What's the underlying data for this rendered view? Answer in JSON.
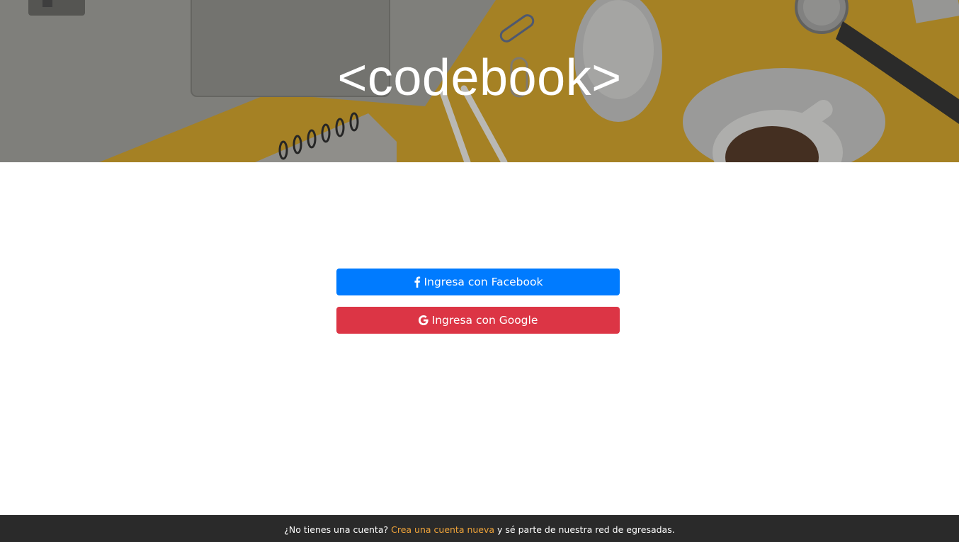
{
  "hero": {
    "title": "<codebook>",
    "background_color": "#b8912a"
  },
  "login": {
    "facebook": {
      "label": "Ingresa con Facebook",
      "icon": "facebook-icon",
      "color": "#007bff"
    },
    "google": {
      "label": "Ingresa con Google",
      "icon": "google-icon",
      "color": "#dc3545"
    }
  },
  "footer": {
    "text_before": "¿No tienes una cuenta?",
    "link_text": "Crea una cuenta nueva",
    "text_after": "y sé parte de nuestra red de egresadas.",
    "link_color": "#f0a43a",
    "background_color": "#2a2a2a"
  }
}
